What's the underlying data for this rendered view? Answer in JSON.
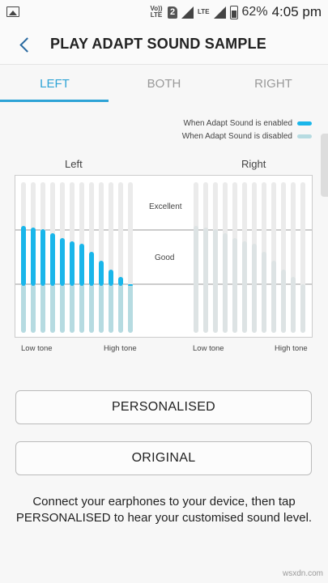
{
  "statusbar": {
    "volte": "Vo)) LTE",
    "sim": "2",
    "lte": "LTE",
    "battery_pct": "62%",
    "time": "4:05 pm"
  },
  "appbar": {
    "title": "PLAY ADAPT SOUND SAMPLE"
  },
  "tabs": [
    {
      "label": "LEFT",
      "active": true
    },
    {
      "label": "BOTH",
      "active": false
    },
    {
      "label": "RIGHT",
      "active": false
    }
  ],
  "legend": {
    "enabled_label": "When Adapt Sound is enabled",
    "disabled_label": "When Adapt Sound is disabled",
    "enabled_color": "#1ab6ea",
    "disabled_color": "#b6dbe1"
  },
  "chart": {
    "left_title": "Left",
    "right_title": "Right",
    "excellent_label": "Excellent",
    "good_label": "Good",
    "low_tone_label": "Low tone",
    "high_tone_label": "High tone",
    "left_enabled_levels": [
      0.71,
      0.7,
      0.69,
      0.66,
      0.63,
      0.61,
      0.59,
      0.54,
      0.48,
      0.42,
      0.37,
      0.32
    ],
    "right_levels": [
      0.71,
      0.7,
      0.69,
      0.66,
      0.63,
      0.61,
      0.59,
      0.54,
      0.48,
      0.42,
      0.37,
      0.32
    ]
  },
  "buttons": {
    "personalised": "PERSONALISED",
    "original": "ORIGINAL"
  },
  "info_text": "Connect your earphones to your device, then tap PERSONALISED to hear your customised sound level.",
  "watermark": "wsxdn.com"
}
